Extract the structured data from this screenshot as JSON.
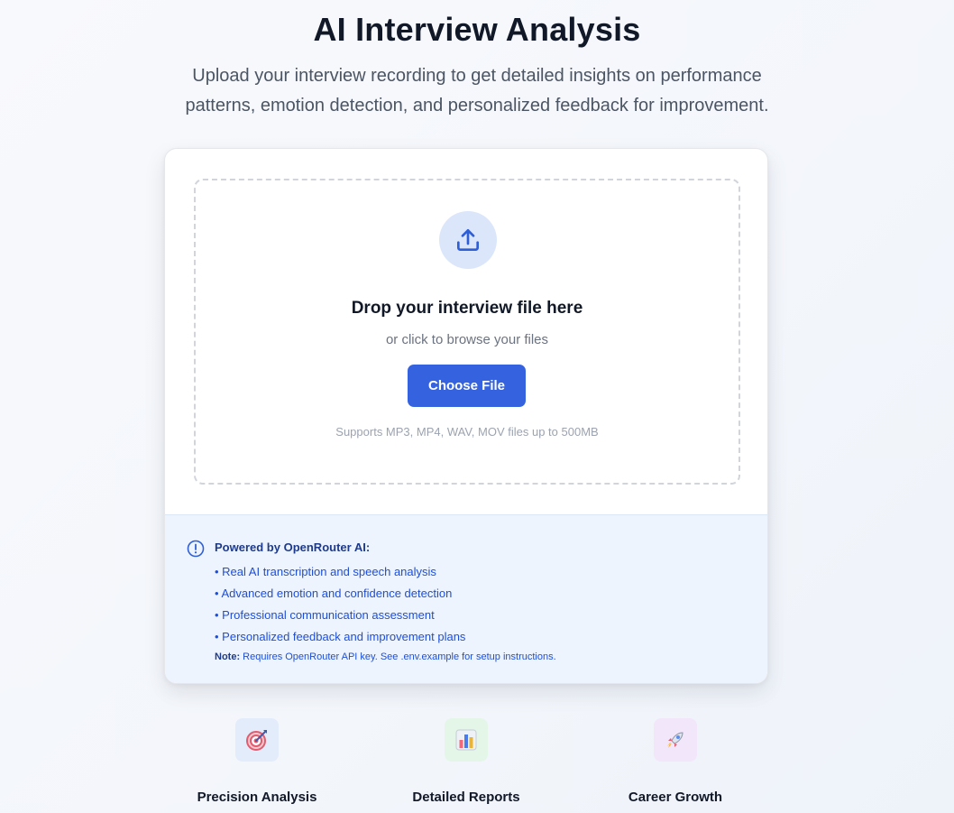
{
  "header": {
    "title": "AI Interview Analysis",
    "subtitle_line1": "Upload your interview recording to get detailed insights on performance",
    "subtitle_line2": "patterns, emotion detection, and personalized feedback for improvement."
  },
  "upload": {
    "icon": "upload-icon",
    "title": "Drop your interview file here",
    "subtitle": "or click to browse your files",
    "button_label": "Choose File",
    "supports": "Supports MP3, MP4, WAV, MOV files up to 500MB"
  },
  "info": {
    "icon": "info-icon",
    "title": "Powered by OpenRouter AI:",
    "items": [
      "• Real AI transcription and speech analysis",
      "• Advanced emotion and confidence detection",
      "• Professional communication assessment",
      "• Personalized feedback and improvement plans"
    ],
    "note_label": "Note:",
    "note_text": "Requires OpenRouter API key. See .env.example for setup instructions."
  },
  "features": [
    {
      "icon": "target-icon",
      "label": "Precision Analysis",
      "bg": "#e3ecfb"
    },
    {
      "icon": "bar-chart-icon",
      "label": "Detailed Reports",
      "bg": "#e3f6e8"
    },
    {
      "icon": "rocket-icon",
      "label": "Career Growth",
      "bg": "#f1e6fa"
    }
  ],
  "colors": {
    "primary": "#3563e0",
    "info_text": "#1d4ed8",
    "info_bg": "#eef4fd"
  }
}
